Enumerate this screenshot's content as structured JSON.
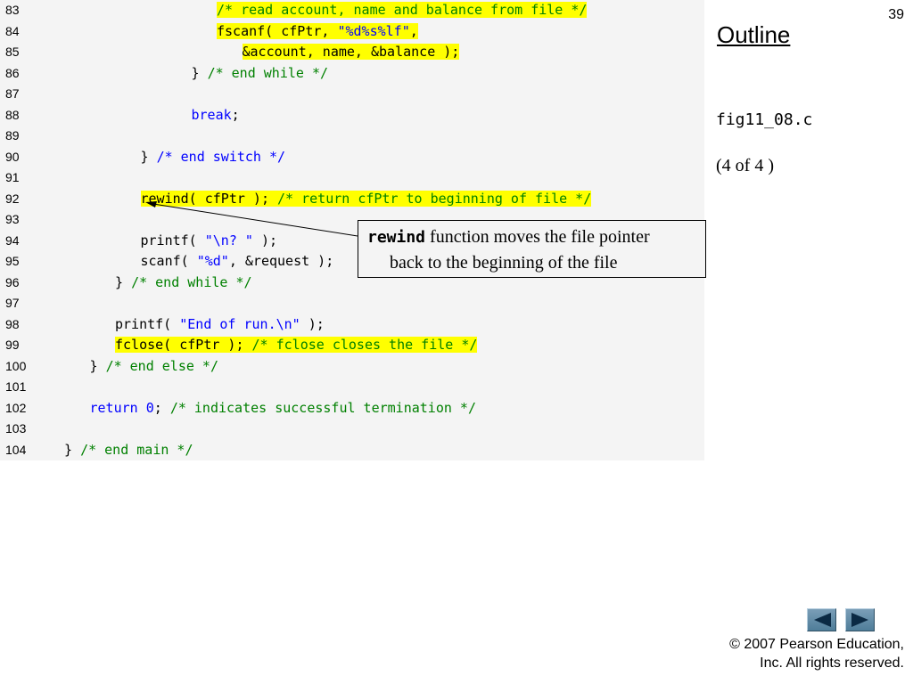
{
  "slide_number": "39",
  "sidebar": {
    "outline_label": "Outline",
    "figure_name": "fig11_08.c",
    "page_indicator": "(4 of 4 )"
  },
  "callout": {
    "code_word": "rewind",
    "line1_rest": " function moves the file pointer",
    "line2": "back to the beginning of the file"
  },
  "footer": {
    "line1": "© 2007 Pearson Education,",
    "line2": "Inc.  All rights reserved."
  },
  "navigation": {
    "prev_icon": "left-arrow-icon",
    "next_icon": "right-arrow-icon"
  },
  "code_lines": [
    {
      "num": "83",
      "indent": 23,
      "segments": [
        {
          "t": "/* read account, name and balance from file */",
          "s": "comment",
          "hl": true
        }
      ]
    },
    {
      "num": "84",
      "indent": 23,
      "segments": [
        {
          "t": "fscanf( cfPtr, ",
          "s": "normal",
          "hl": true
        },
        {
          "t": "\"%d%s%lf\"",
          "s": "string",
          "hl": true
        },
        {
          "t": ",",
          "s": "normal",
          "hl": true
        }
      ]
    },
    {
      "num": "85",
      "indent": 26,
      "segments": [
        {
          "t": "&account, name, &balance );",
          "s": "normal",
          "hl": true
        }
      ]
    },
    {
      "num": "86",
      "indent": 20,
      "segments": [
        {
          "t": "} ",
          "s": "normal",
          "hl": false
        },
        {
          "t": "/* end while */",
          "s": "comment",
          "hl": false
        }
      ]
    },
    {
      "num": "87",
      "indent": 0,
      "segments": []
    },
    {
      "num": "88",
      "indent": 20,
      "segments": [
        {
          "t": "break",
          "s": "keyword",
          "hl": false
        },
        {
          "t": ";",
          "s": "normal",
          "hl": false
        }
      ]
    },
    {
      "num": "89",
      "indent": 0,
      "segments": []
    },
    {
      "num": "90",
      "indent": 14,
      "segments": [
        {
          "t": "} ",
          "s": "normal",
          "hl": false
        },
        {
          "t": "/* end switch */",
          "s": "keyword",
          "hl": false
        }
      ]
    },
    {
      "num": "91",
      "indent": 0,
      "segments": []
    },
    {
      "num": "92",
      "indent": 14,
      "segments": [
        {
          "t": "rewind( cfPtr ); ",
          "s": "normal",
          "hl": true
        },
        {
          "t": "/* return cfPtr to beginning of file */",
          "s": "comment",
          "hl": true
        }
      ]
    },
    {
      "num": "93",
      "indent": 0,
      "segments": []
    },
    {
      "num": "94",
      "indent": 14,
      "segments": [
        {
          "t": "printf( ",
          "s": "normal",
          "hl": false
        },
        {
          "t": "\"\\n? \"",
          "s": "string",
          "hl": false
        },
        {
          "t": " );",
          "s": "normal",
          "hl": false
        }
      ]
    },
    {
      "num": "95",
      "indent": 14,
      "segments": [
        {
          "t": "scanf( ",
          "s": "normal",
          "hl": false
        },
        {
          "t": "\"%d\"",
          "s": "string",
          "hl": false
        },
        {
          "t": ", &request );",
          "s": "normal",
          "hl": false
        }
      ]
    },
    {
      "num": "96",
      "indent": 11,
      "segments": [
        {
          "t": "} ",
          "s": "normal",
          "hl": false
        },
        {
          "t": "/* end while */",
          "s": "comment",
          "hl": false
        }
      ]
    },
    {
      "num": "97",
      "indent": 0,
      "segments": []
    },
    {
      "num": "98",
      "indent": 11,
      "segments": [
        {
          "t": "printf( ",
          "s": "normal",
          "hl": false
        },
        {
          "t": "\"End of run.\\n\"",
          "s": "string",
          "hl": false
        },
        {
          "t": " );",
          "s": "normal",
          "hl": false
        }
      ]
    },
    {
      "num": "99",
      "indent": 11,
      "segments": [
        {
          "t": "fclose( cfPtr ); ",
          "s": "normal",
          "hl": true
        },
        {
          "t": "/* fclose closes the file */",
          "s": "comment",
          "hl": true
        }
      ]
    },
    {
      "num": "100",
      "indent": 8,
      "segments": [
        {
          "t": "} ",
          "s": "normal",
          "hl": false
        },
        {
          "t": "/* end else */",
          "s": "comment",
          "hl": false
        }
      ]
    },
    {
      "num": "101",
      "indent": 0,
      "segments": []
    },
    {
      "num": "102",
      "indent": 8,
      "segments": [
        {
          "t": "return ",
          "s": "keyword",
          "hl": false
        },
        {
          "t": "0",
          "s": "number",
          "hl": false
        },
        {
          "t": "; ",
          "s": "normal",
          "hl": false
        },
        {
          "t": "/* indicates successful termination */",
          "s": "comment",
          "hl": false
        }
      ]
    },
    {
      "num": "103",
      "indent": 0,
      "segments": []
    },
    {
      "num": "104",
      "indent": 5,
      "segments": [
        {
          "t": "} ",
          "s": "normal",
          "hl": false
        },
        {
          "t": "/* end main */",
          "s": "comment",
          "hl": false
        }
      ]
    }
  ]
}
